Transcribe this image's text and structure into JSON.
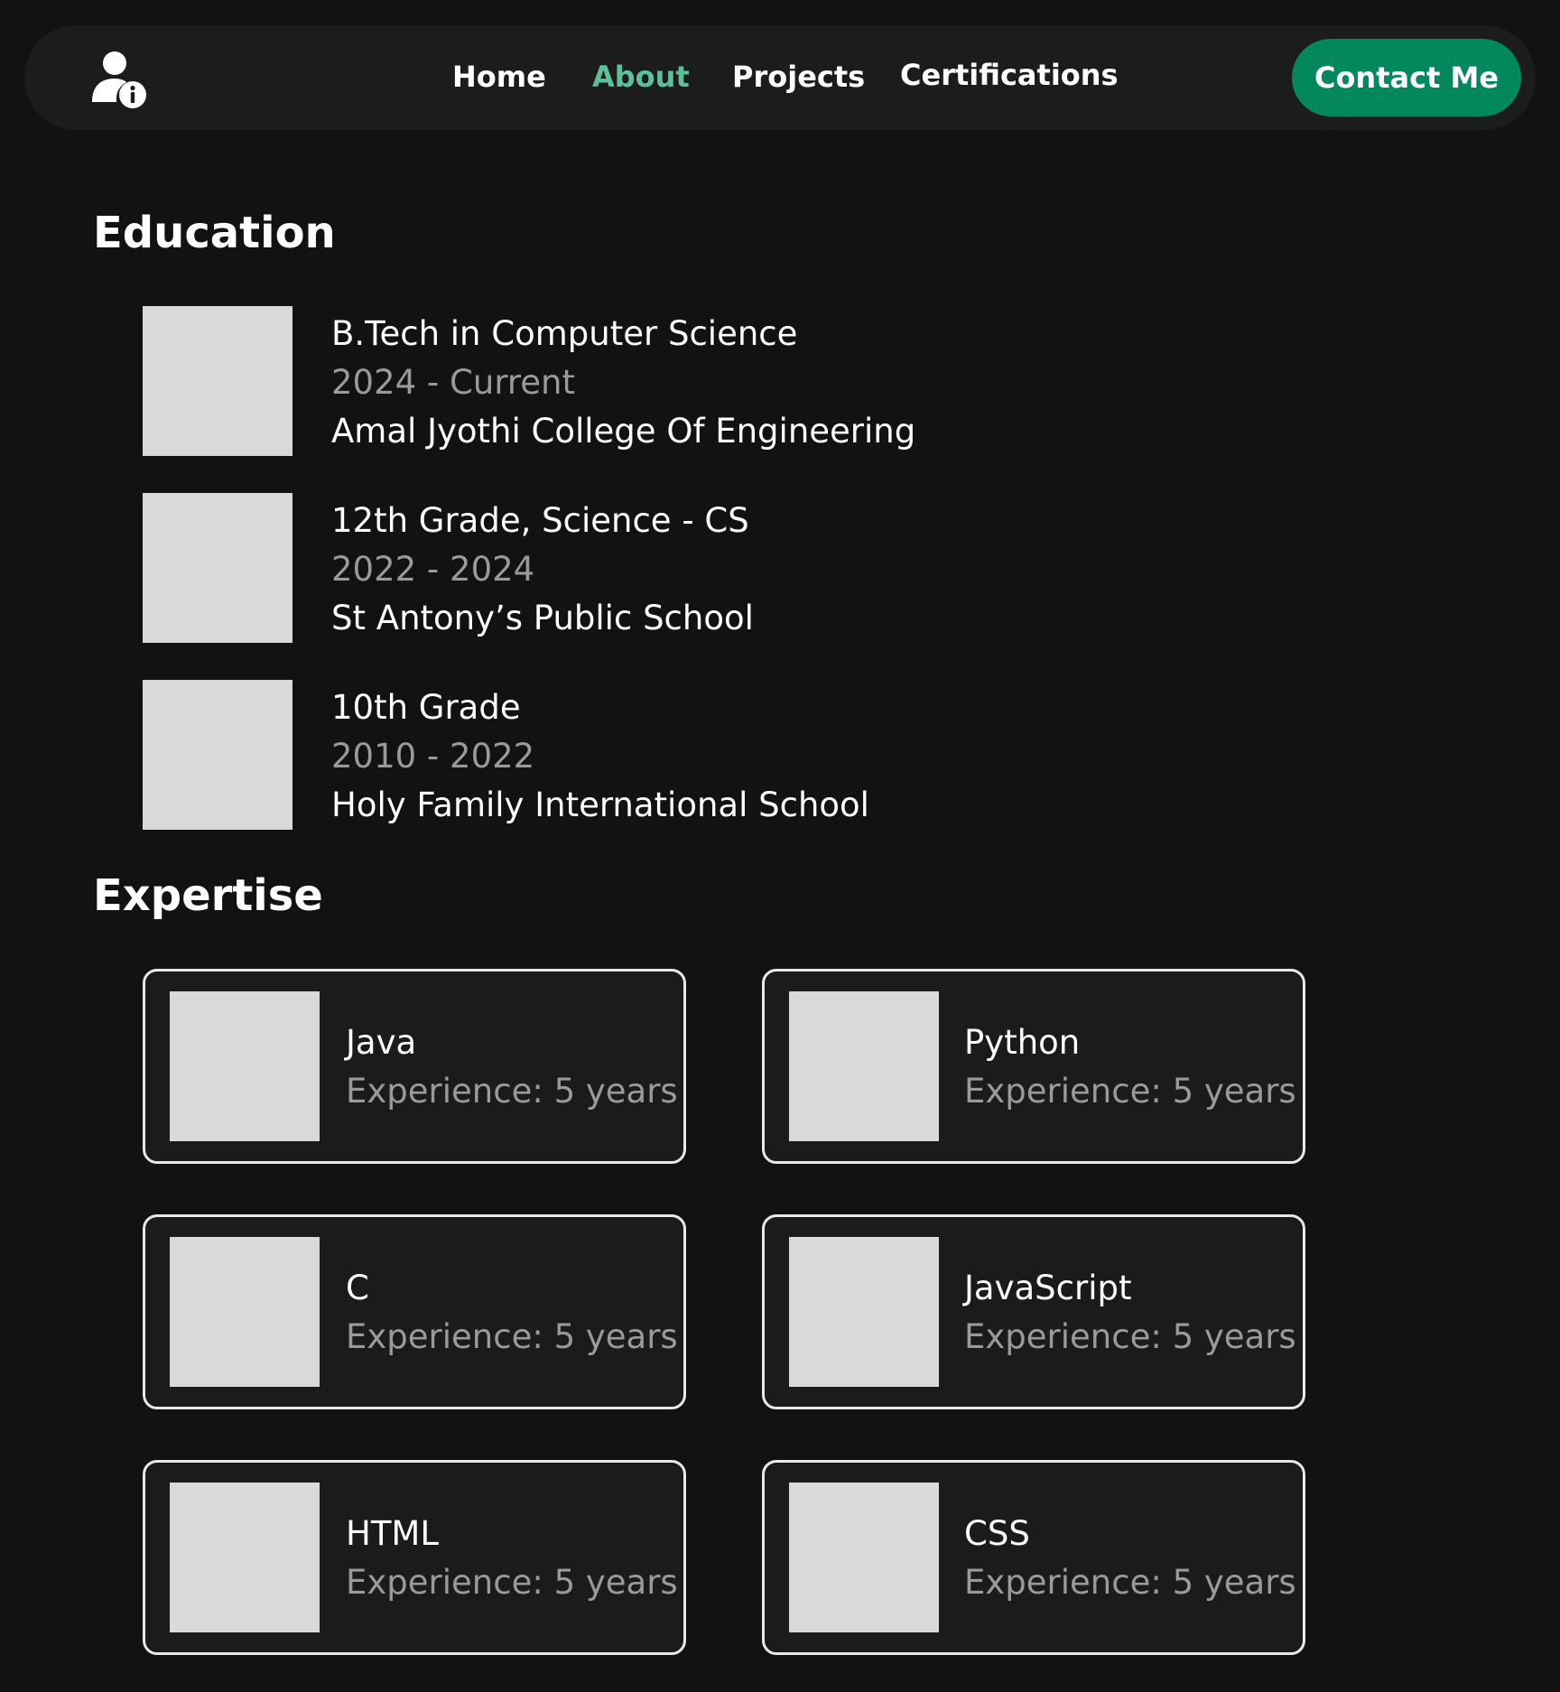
{
  "nav": {
    "logo_icon": "user-info-icon",
    "links": [
      {
        "label": "Home",
        "active": false
      },
      {
        "label": "About",
        "active": true
      },
      {
        "label": "Projects",
        "active": false
      },
      {
        "label": "Certifications",
        "active": false
      }
    ],
    "contact_label": "Contact Me"
  },
  "colors": {
    "background": "#121212",
    "navbar": "#1c1c1c",
    "accent": "#5cc19b",
    "button": "#03875c",
    "muted_text": "#9a9a9a",
    "placeholder": "#d9d9d9"
  },
  "education": {
    "title": "Education",
    "items": [
      {
        "degree": "B.Tech in Computer Science",
        "years": "2024 - Current",
        "school": "Amal Jyothi College Of Engineering"
      },
      {
        "degree": "12th Grade, Science - CS",
        "years": "2022 - 2024",
        "school": "St Antony’s Public School"
      },
      {
        "degree": "10th Grade",
        "years": "2010 - 2022",
        "school": "Holy Family International School"
      }
    ]
  },
  "expertise": {
    "title": "Expertise",
    "items": [
      {
        "name": "Java",
        "experience": "Experience: 5 years"
      },
      {
        "name": "Python",
        "experience": "Experience: 5 years"
      },
      {
        "name": "C",
        "experience": "Experience: 5 years"
      },
      {
        "name": "JavaScript",
        "experience": "Experience: 5 years"
      },
      {
        "name": "HTML",
        "experience": "Experience: 5 years"
      },
      {
        "name": "CSS",
        "experience": "Experience: 5 years"
      }
    ]
  }
}
